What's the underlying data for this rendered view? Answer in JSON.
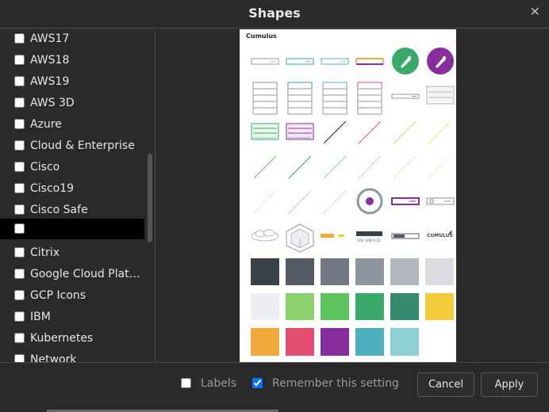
{
  "dialog": {
    "title": "Shapes",
    "close_glyph": "✕"
  },
  "library_list": [
    {
      "label": "AWS17",
      "checked": false,
      "selected": false
    },
    {
      "label": "AWS18",
      "checked": false,
      "selected": false
    },
    {
      "label": "AWS19",
      "checked": false,
      "selected": false
    },
    {
      "label": "AWS 3D",
      "checked": false,
      "selected": false
    },
    {
      "label": "Azure",
      "checked": false,
      "selected": false
    },
    {
      "label": "Cloud & Enterprise",
      "checked": false,
      "selected": false
    },
    {
      "label": "Cisco",
      "checked": false,
      "selected": false
    },
    {
      "label": "Cisco19",
      "checked": false,
      "selected": false
    },
    {
      "label": "Cisco Safe",
      "checked": false,
      "selected": false
    },
    {
      "label": "",
      "checked": false,
      "selected": true
    },
    {
      "label": "Citrix",
      "checked": false,
      "selected": false
    },
    {
      "label": "Google Cloud Plat…",
      "checked": false,
      "selected": false
    },
    {
      "label": "GCP Icons",
      "checked": false,
      "selected": false
    },
    {
      "label": "IBM",
      "checked": false,
      "selected": false
    },
    {
      "label": "Kubernetes",
      "checked": false,
      "selected": false
    },
    {
      "label": "Network",
      "checked": false,
      "selected": false
    }
  ],
  "preview": {
    "library_name": "Cumulus",
    "ip_text": "192.168.0.22",
    "brand_text": "CUMULUS",
    "swatch_colors": [
      [
        "#3b4149",
        "#545a64",
        "#727984",
        "#8f96a0",
        "#b2b7bf",
        "#d9dbe0"
      ],
      [
        "#eceef1",
        "#8bd26f",
        "#5cc25c",
        "#3aaa6b",
        "#34896e",
        "#f2cc3d"
      ],
      [
        "#f2a93b",
        "#e34d6f",
        "#872e9e",
        "#4db1c0",
        "#8ecfd7"
      ]
    ]
  },
  "footer": {
    "labels_checkbox": {
      "label": "Labels",
      "checked": false
    },
    "remember_checkbox": {
      "label": "Remember this setting",
      "checked": true
    },
    "cancel_label": "Cancel",
    "apply_label": "Apply"
  }
}
